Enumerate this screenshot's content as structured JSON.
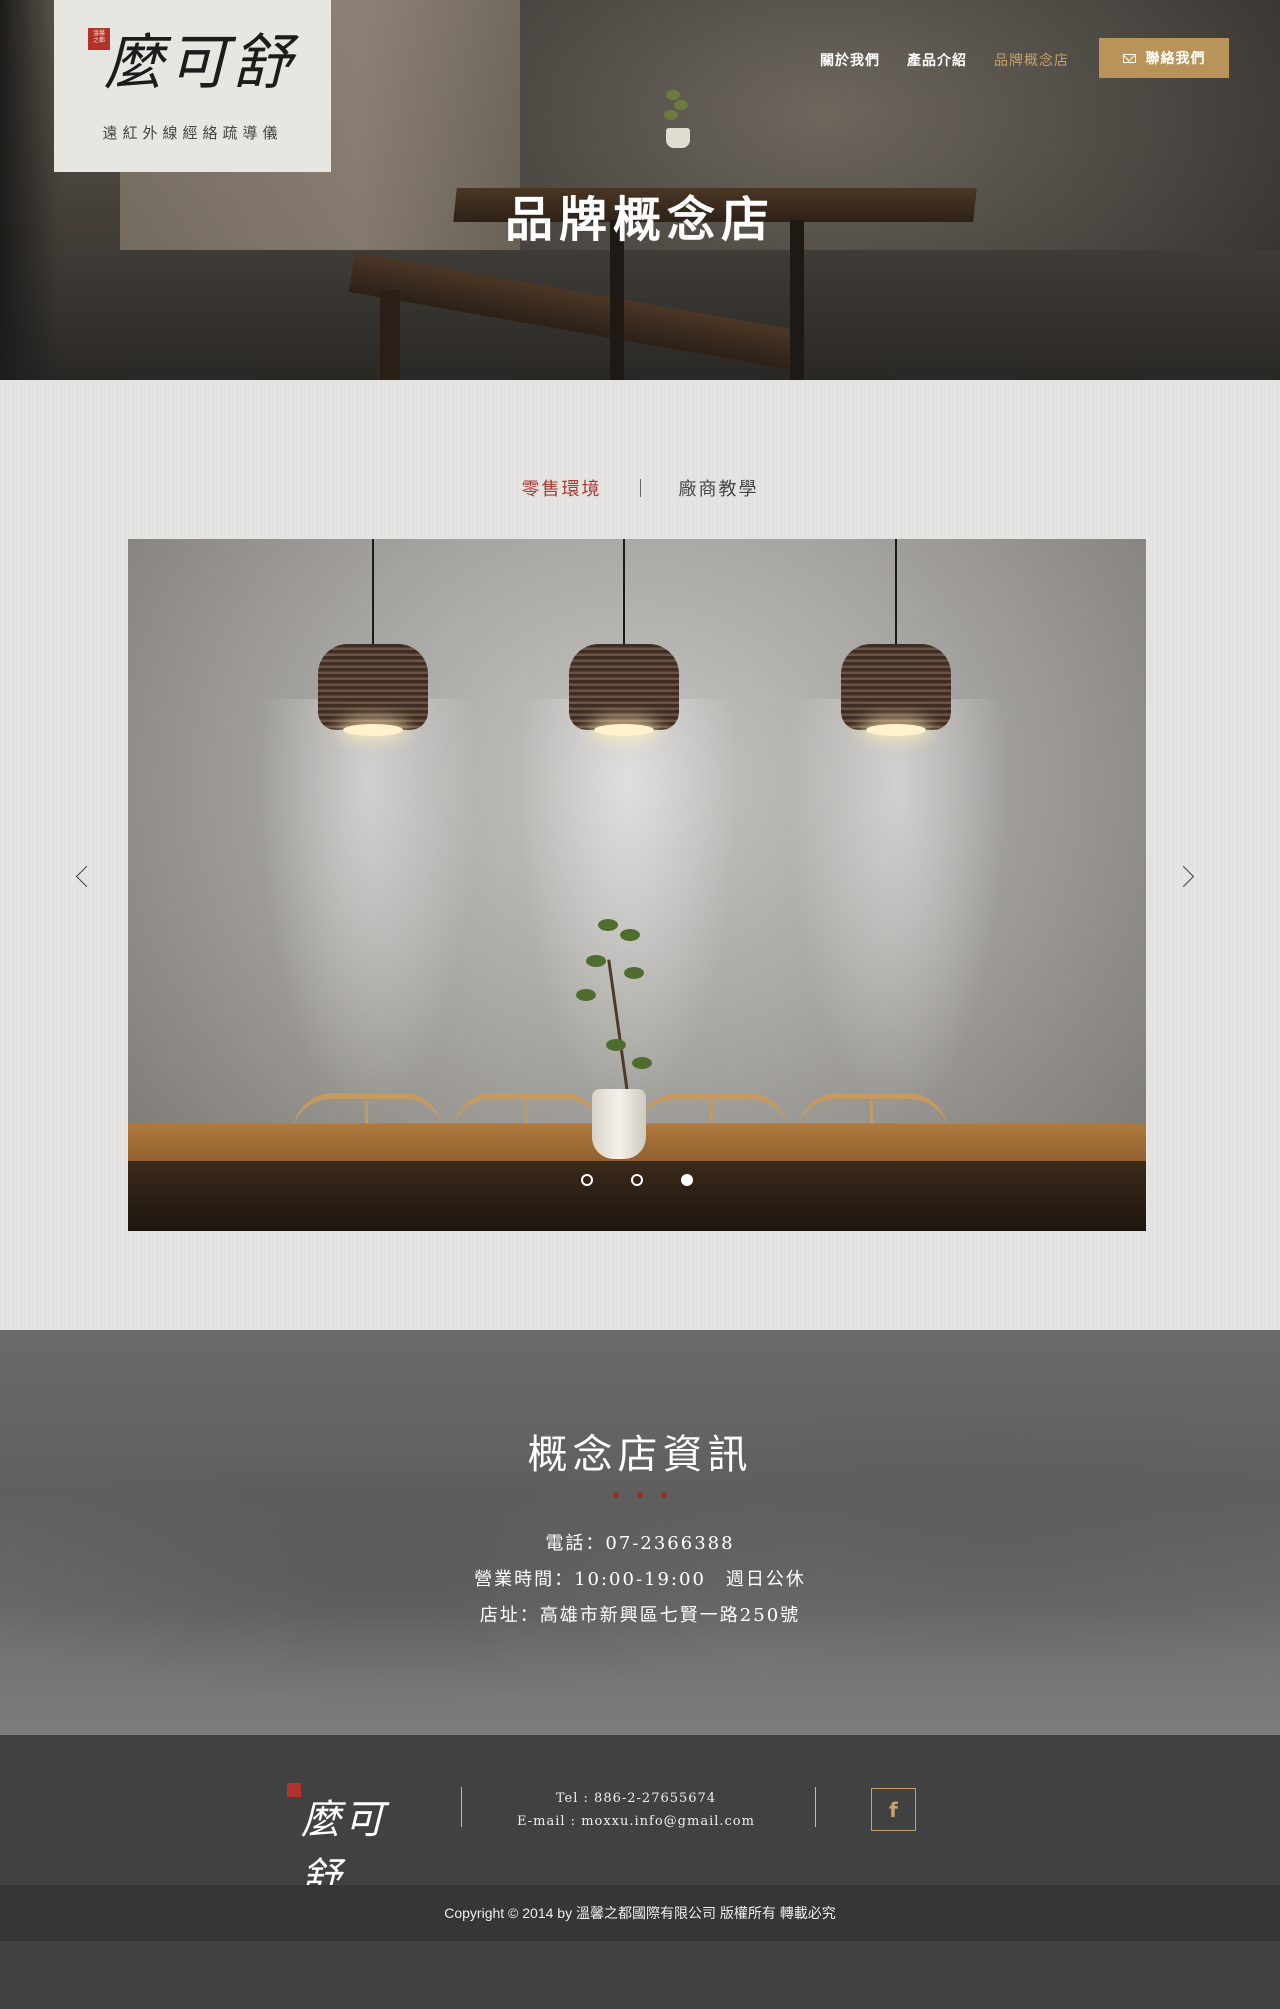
{
  "logo": {
    "name": "麼可舒",
    "tagline": "遠紅外線經絡疏導儀",
    "seal_text": "溫馨之都"
  },
  "nav": {
    "items": [
      {
        "label": "關於我們",
        "active": false
      },
      {
        "label": "產品介紹",
        "active": false
      },
      {
        "label": "品牌概念店",
        "active": true
      }
    ],
    "contact_label": "聯絡我們"
  },
  "hero": {
    "title": "品牌概念店"
  },
  "tabs": [
    {
      "label": "零售環境",
      "active": true
    },
    {
      "label": "廠商教學",
      "active": false
    }
  ],
  "slider": {
    "slide_count": 3,
    "active_index": 2
  },
  "info": {
    "title": "概念店資訊",
    "phone": "電話：07-2366388",
    "hours": "營業時間：10:00-19:00　週日公休",
    "address": "店址：高雄市新興區七賢一路250號"
  },
  "footer": {
    "logo_text": "麼可舒",
    "tel": "Tel : 886-2-27655674",
    "email": "E-mail :  moxxu.info@gmail.com",
    "facebook_label": "f",
    "copyright": "Copyright © 2014 by 溫馨之都國際有限公司 版權所有 轉載必究"
  },
  "colors": {
    "accent_gold": "#b8935a",
    "active_red": "#a83a32",
    "footer_bg": "#414141"
  }
}
